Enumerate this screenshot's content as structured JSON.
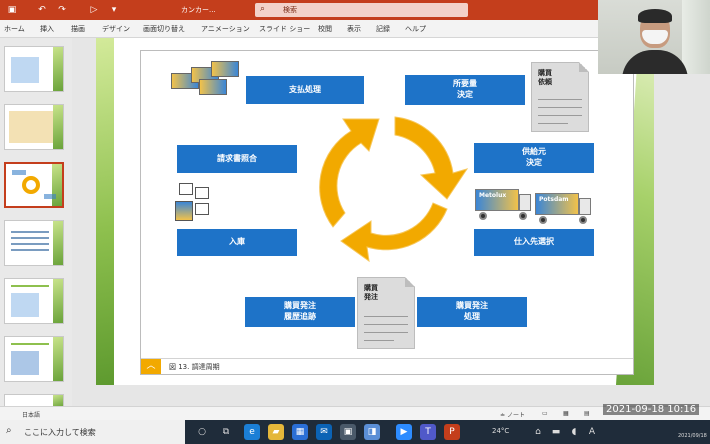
{
  "titlebar": {
    "doc_title": "カンカー...",
    "search_placeholder": "検索"
  },
  "ribbon": {
    "tabs": [
      "ホーム",
      "挿入",
      "描画",
      "デザイン",
      "画面切り替え",
      "アニメーション",
      "スライド ショー",
      "校閲",
      "表示",
      "記録",
      "ヘルプ"
    ]
  },
  "slide": {
    "boxes": {
      "payment": "支払処理",
      "requirement": "所要量\n決定",
      "invoice_check": "請求書照合",
      "supplier": "供給元\n決定",
      "receiving": "入庫",
      "vendor_select": "仕入先選択",
      "po_history": "購買発注\n履歴追跡",
      "po_process": "購買発注\n処理"
    },
    "docs": {
      "purchase_request": "購買\n依頼",
      "purchase_order": "購買\n発注"
    },
    "trucks": [
      "Metolux",
      "Potsdam"
    ],
    "caption": "図 13. 調達周期"
  },
  "statusbar": {
    "language": "日本語",
    "notes": "ノート"
  },
  "taskbar": {
    "search_placeholder": "ここに入力して検索",
    "weather": "24°C",
    "datetime": "2021-09-18 10:16",
    "date_small": "2021/09/18"
  },
  "colors": {
    "accent": "#c43e1c",
    "box_blue": "#1e73c8",
    "cycle_orange": "#f2a900",
    "slide_green": "#8ec04e"
  }
}
